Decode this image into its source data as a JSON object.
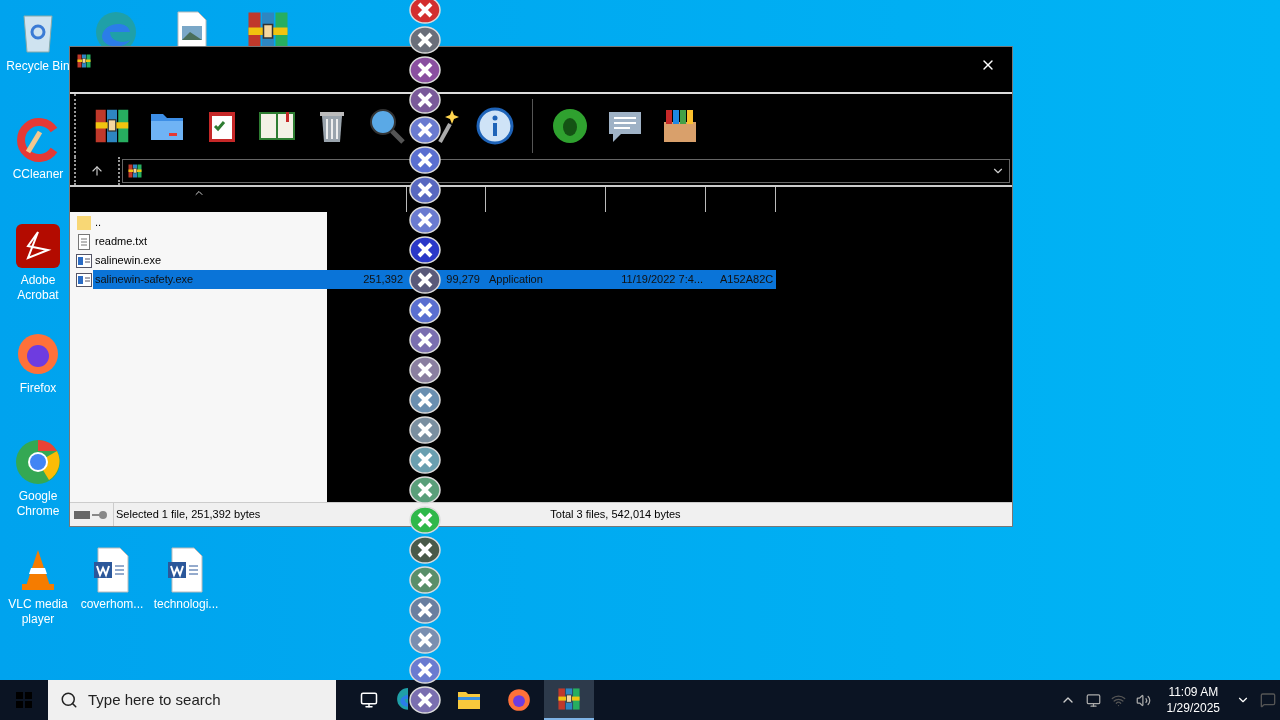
{
  "desktop_icons": [
    {
      "kind": "recycle",
      "label": "Recycle Bin"
    },
    {
      "kind": "edge"
    },
    {
      "kind": "image"
    },
    {
      "kind": "winrar"
    },
    {
      "kind": "ccleaner",
      "label": "CCleaner"
    },
    {
      "kind": "acrobat",
      "label": "Adobe Acrobat"
    },
    {
      "kind": "firefox",
      "label": "Firefox"
    },
    {
      "kind": "chrome",
      "label": "Google Chrome"
    },
    {
      "kind": "vlc",
      "label": "VLC media player"
    },
    {
      "kind": "word",
      "label": "coverhom..."
    },
    {
      "kind": "word",
      "label": "technologi..."
    }
  ],
  "window": {
    "toolbar": [
      {
        "kind": "archive"
      },
      {
        "kind": "folder"
      },
      {
        "kind": "clipboard"
      },
      {
        "kind": "book"
      },
      {
        "kind": "trash"
      },
      {
        "kind": "search"
      },
      {
        "kind": "wand"
      },
      {
        "kind": "info"
      },
      {
        "kind": "bug"
      },
      {
        "kind": "comment"
      },
      {
        "kind": "box"
      }
    ],
    "files": [
      {
        "name": "..",
        "kind": "folder",
        "selected": false
      },
      {
        "name": "readme.txt",
        "kind": "text",
        "selected": false
      },
      {
        "name": "salinewin.exe",
        "kind": "exe",
        "selected": false
      },
      {
        "name": "salinewin-safety.exe",
        "kind": "exe",
        "selected": true,
        "size": "251,392",
        "packed": "99,279",
        "type": "Application",
        "modified": "11/19/2022 7:4...",
        "crc": "A152A82C"
      }
    ],
    "status_bar": {
      "selection": "Selected 1 file, 251,392 bytes",
      "total": "Total 3 files, 542,014 bytes"
    }
  },
  "taskbar": {
    "search": {
      "placeholder": "Type here to search"
    },
    "apps": [
      {
        "kind": "taskview",
        "selected": false
      },
      {
        "kind": "edge",
        "selected": false
      },
      {
        "kind": "explorer",
        "selected": false
      },
      {
        "kind": "firefox",
        "selected": false
      },
      {
        "kind": "winrar",
        "selected": true
      }
    ],
    "time": "11:09 AM",
    "date": "1/29/2025"
  }
}
